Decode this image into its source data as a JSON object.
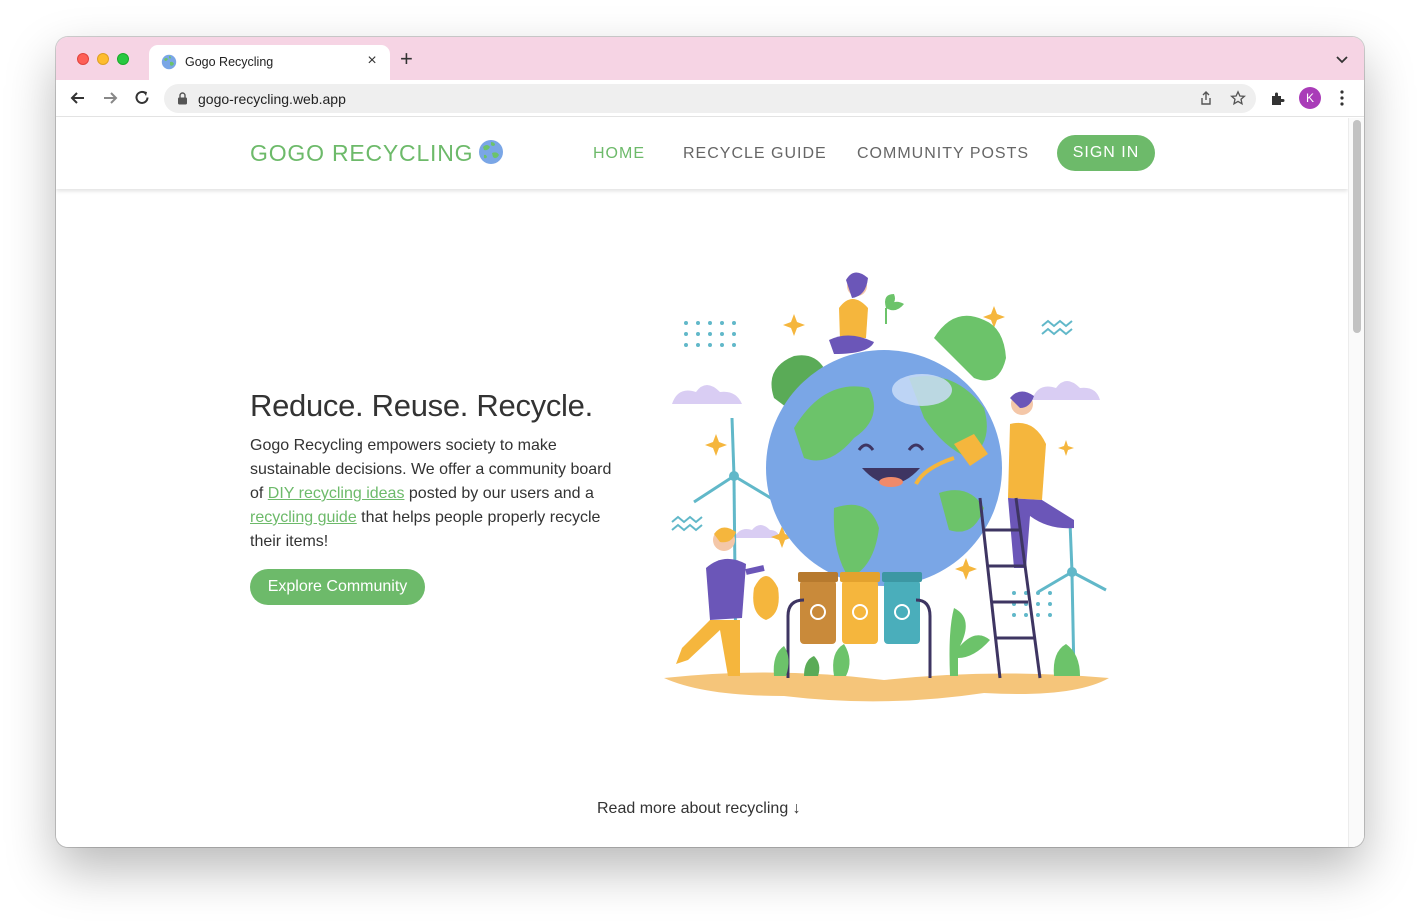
{
  "browser": {
    "tab_title": "Gogo Recycling",
    "tab_close": "×",
    "new_tab": "+",
    "url": "gogo-recycling.web.app",
    "profile_initial": "K"
  },
  "header": {
    "brand": "GOGO RECYCLING",
    "nav": {
      "home": "HOME",
      "guide": "RECYCLE GUIDE",
      "posts": "COMMUNITY POSTS"
    },
    "signin": "SIGN IN"
  },
  "hero": {
    "title": "Reduce. Reuse. Recycle.",
    "text_1": "Gogo Recycling empowers society to make sustainable decisions. We offer a community board of ",
    "link_1": "DIY recycling ideas",
    "text_2": " posted by our users and a ",
    "link_2": "recycling guide",
    "text_3": " that helps people properly recycle their items!",
    "cta": "Explore Community"
  },
  "read_more": "Read more about recycling ↓",
  "colors": {
    "brand_green": "#6dba6a",
    "tabstrip_pink": "#f6d4e4",
    "profile_purple": "#a93cb8"
  },
  "icons": [
    "globe-favicon-icon",
    "back-arrow-icon",
    "forward-arrow-icon",
    "reload-icon",
    "lock-icon",
    "share-icon",
    "star-icon",
    "extensions-icon",
    "more-vert-icon",
    "chevron-down-icon"
  ]
}
